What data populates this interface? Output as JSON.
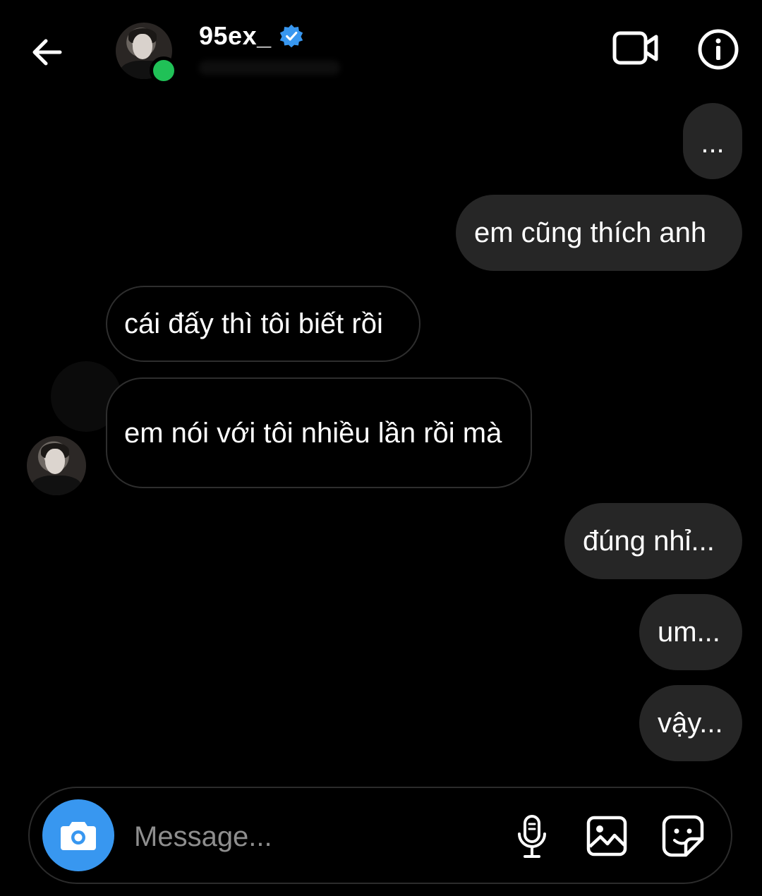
{
  "header": {
    "username": "95ex_",
    "verified": true,
    "online": true,
    "icons": {
      "back": "arrow-left-icon",
      "video": "video-camera-icon",
      "info": "info-icon",
      "verified": "verified-badge-icon"
    }
  },
  "messages": [
    {
      "side": "outgoing",
      "text": "..."
    },
    {
      "side": "outgoing",
      "text": "em cũng thích anh"
    },
    {
      "side": "incoming",
      "text": "cái đấy thì tôi biết rồi"
    },
    {
      "side": "incoming",
      "text": "em nói với tôi nhiều lần rồi mà"
    },
    {
      "side": "outgoing",
      "text": "đúng nhỉ..."
    },
    {
      "side": "outgoing",
      "text": "um..."
    },
    {
      "side": "outgoing",
      "text": "vậy..."
    }
  ],
  "composer": {
    "placeholder": "Message...",
    "icons": {
      "camera": "camera-icon",
      "mic": "microphone-icon",
      "gallery": "image-icon",
      "sticker": "sticker-icon"
    }
  },
  "colors": {
    "background": "#000000",
    "outgoing_bubble": "#262626",
    "incoming_border": "#2e2e2e",
    "accent": "#3897f0",
    "online": "#20c157"
  }
}
